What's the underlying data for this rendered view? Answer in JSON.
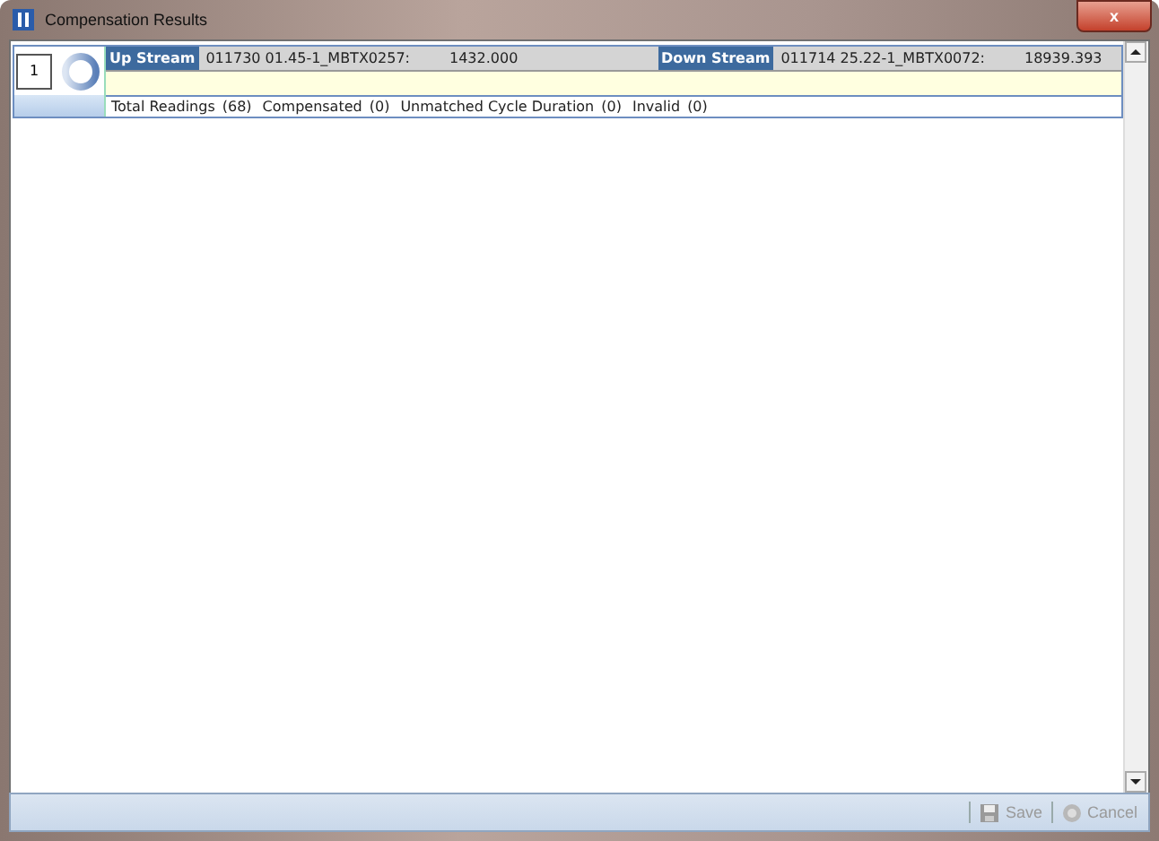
{
  "window": {
    "title": "Compensation Results",
    "close": "x"
  },
  "results": [
    {
      "index": "1",
      "upstream": {
        "label": "Up Stream",
        "meter": "011730 01.45-1_MBTX0257:",
        "value": "1432.000"
      },
      "downstream": {
        "label": "Down Stream",
        "meter": "011714 25.22-1_MBTX0072:",
        "value": "18939.393"
      },
      "stats": [
        {
          "label": "Total Readings",
          "count": "(68)"
        },
        {
          "label": "Compensated",
          "count": "(0)"
        },
        {
          "label": "Unmatched Cycle Duration",
          "count": "(0)"
        },
        {
          "label": "Invalid",
          "count": "(0)"
        }
      ]
    }
  ],
  "toolbar": [
    {
      "kind": "save",
      "label": "Save",
      "disabled": true
    },
    {
      "kind": "cancel",
      "label": "Cancel",
      "disabled": true
    }
  ]
}
